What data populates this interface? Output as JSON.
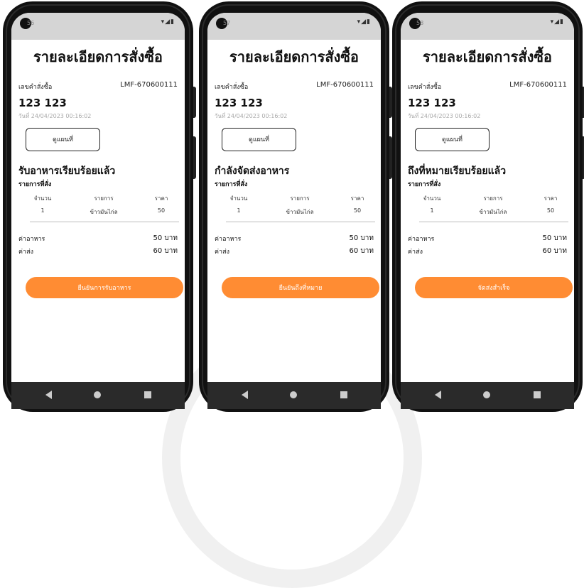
{
  "colors": {
    "accent": "#ff8c33",
    "status_bar": "#d5d5d5",
    "nav_bar": "#2a2a2a"
  },
  "icons": {
    "status": "wifi-signal-battery-icons",
    "nav": [
      "back-icon",
      "home-icon",
      "recent-apps-icon"
    ]
  },
  "screens": [
    {
      "status_time": "56",
      "title": "รายละเอียดการสั่งซื้อ",
      "order_label": "เลขคำสั่งซื้อ",
      "order_id": "LMF-670600111",
      "customer_name": "123 123",
      "date": "วันที่ 24/04/2023 00:16:02",
      "map_button": "ดูแผนที่",
      "status": "รับอาหารเรียบร้อยแล้ว",
      "items_title": "รายการที่สั่ง",
      "columns": {
        "qty": "จำนวน",
        "item": "รายการ",
        "price": "ราคา"
      },
      "item_row": {
        "qty": "1",
        "name": "ข้าวมันไก่ล",
        "price": "50"
      },
      "food_cost_label": "ค่าอาหาร",
      "food_cost": "50 บาท",
      "shipping_label": "ค่าส่ง",
      "shipping_cost": "60 บาท",
      "action_button": "ยืนยันการรับอาหาร"
    },
    {
      "status_time": "57",
      "title": "รายละเอียดการสั่งซื้อ",
      "order_label": "เลขคำสั่งซื้อ",
      "order_id": "LMF-670600111",
      "customer_name": "123 123",
      "date": "วันที่ 24/04/2023 00:16:02",
      "map_button": "ดูแผนที่",
      "status": "กำลังจัดส่งอาหาร",
      "items_title": "รายการที่สั่ง",
      "columns": {
        "qty": "จำนวน",
        "item": "รายการ",
        "price": "ราคา"
      },
      "item_row": {
        "qty": "1",
        "name": "ข้าวมันไก่ล",
        "price": "50"
      },
      "food_cost_label": "ค่าอาหาร",
      "food_cost": "50 บาท",
      "shipping_label": "ค่าส่ง",
      "shipping_cost": "60 บาท",
      "action_button": "ยืนยันถึงที่หมาย"
    },
    {
      "status_time": "58",
      "title": "รายละเอียดการสั่งซื้อ",
      "order_label": "เลขคำสั่งซื้อ",
      "order_id": "LMF-670600111",
      "customer_name": "123 123",
      "date": "วันที่ 24/04/2023 00:16:02",
      "map_button": "ดูแผนที่",
      "status": "ถึงที่หมายเรียบร้อยแล้ว",
      "items_title": "รายการที่สั่ง",
      "columns": {
        "qty": "จำนวน",
        "item": "รายการ",
        "price": "ราคา"
      },
      "item_row": {
        "qty": "1",
        "name": "ข้าวมันไก่ล",
        "price": "50"
      },
      "food_cost_label": "ค่าอาหาร",
      "food_cost": "50 บาท",
      "shipping_label": "ค่าส่ง",
      "shipping_cost": "60 บาท",
      "action_button": "จัดส่งสำเร็จ"
    }
  ]
}
